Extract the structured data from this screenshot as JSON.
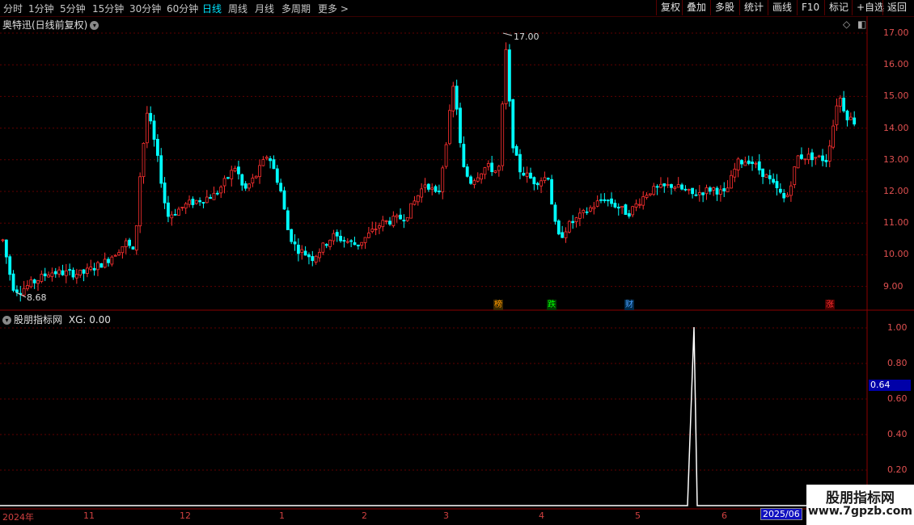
{
  "toolbar": {
    "periods": [
      "分时",
      "1分钟",
      "5分钟",
      "15分钟",
      "30分钟",
      "60分钟",
      "日线",
      "周线",
      "月线",
      "多周期",
      "更多 >"
    ],
    "active_period": "日线",
    "buttons": [
      "复权",
      "叠加",
      "多股",
      "统计",
      "画线",
      "F10",
      "标记",
      "+自选",
      "返回"
    ]
  },
  "main_chart": {
    "title": "奥特迅(日线前复权)",
    "price_ticks": [
      "17.00",
      "16.00",
      "15.00",
      "14.00",
      "13.00",
      "12.00",
      "11.00",
      "10.00",
      "9.00"
    ],
    "high_label": "17.00",
    "low_label": "8.68",
    "event_tags": [
      {
        "text": "榜",
        "color": "#ff9900"
      },
      {
        "text": "跌",
        "color": "#00ff00"
      },
      {
        "text": "财",
        "color": "#4aa0ff"
      },
      {
        "text": "涨",
        "color": "#ff3030"
      }
    ]
  },
  "indicator": {
    "title": "股朋指标网",
    "value_text": "XG: 0.00",
    "ticks": [
      "1.00",
      "0.80",
      "0.60",
      "0.40",
      "0.20"
    ],
    "current_badge": "0.64"
  },
  "dates": [
    "2024年",
    "11",
    "12",
    "1",
    "2",
    "3",
    "4",
    "5",
    "6",
    "2025/06"
  ],
  "watermark": {
    "line1": "股朋指标网",
    "line2": "www.7gpzb.com"
  },
  "colors": {
    "up": "#ff3030",
    "down": "#00ffff",
    "bg": "#000000",
    "grid": "#600000"
  }
}
